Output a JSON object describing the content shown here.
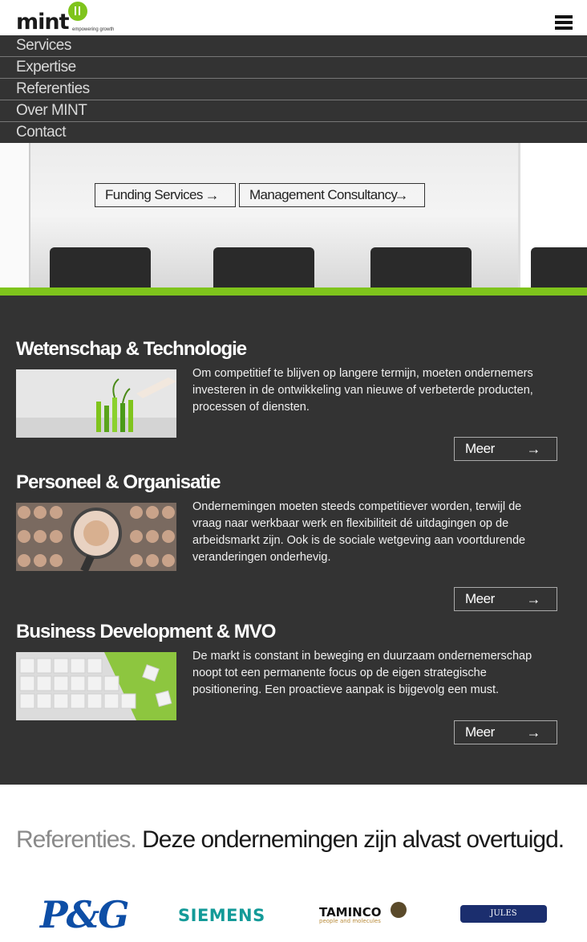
{
  "logo": {
    "word": "mint",
    "tagline": "empowering growth"
  },
  "nav": {
    "items": [
      "Services",
      "Expertise",
      "Referenties",
      "Over MINT",
      "Contact"
    ]
  },
  "hero": {
    "buttons": [
      {
        "label": "Funding Services",
        "arrow": "→"
      },
      {
        "label": "Management Consultancy",
        "arrow": "→"
      }
    ]
  },
  "services": [
    {
      "title": "Wetenschap & Technologie",
      "text": "Om competitief te blijven op langere termijn, moeten ondernemers investeren in de ontwikkeling van nieuwe of verbeterde producten, processen of diensten.",
      "button": "Meer",
      "arrow": "→"
    },
    {
      "title": "Personeel & Organisatie",
      "text": "Ondernemingen moeten steeds competitiever worden, terwijl de vraag naar werkbaar werk en flexibiliteit dé uitdagingen op de arbeidsmarkt zijn. Ook is de sociale wetgeving aan voortdurende veranderingen onderhevig.",
      "button": "Meer",
      "arrow": "→"
    },
    {
      "title": "Business Development & MVO",
      "text": "De markt is constant in beweging en duurzaam ondernemerschap noopt tot een permanente focus op de eigen strategische positionering. Een proactieve aanpak is bijgevolg een must.",
      "button": "Meer",
      "arrow": "→"
    }
  ],
  "referenties": {
    "title_grey": "Referenties.",
    "title_dark": "Deze ondernemingen zijn alvast overtuigd.",
    "logos": {
      "pg": "P&G",
      "siemens": "SIEMENS",
      "taminco": "TAMINCO",
      "taminco_sub": "people and molecules",
      "jules": "JULES DESTROOPER"
    }
  },
  "colors": {
    "accent": "#7fc41c",
    "dark": "#333333"
  }
}
